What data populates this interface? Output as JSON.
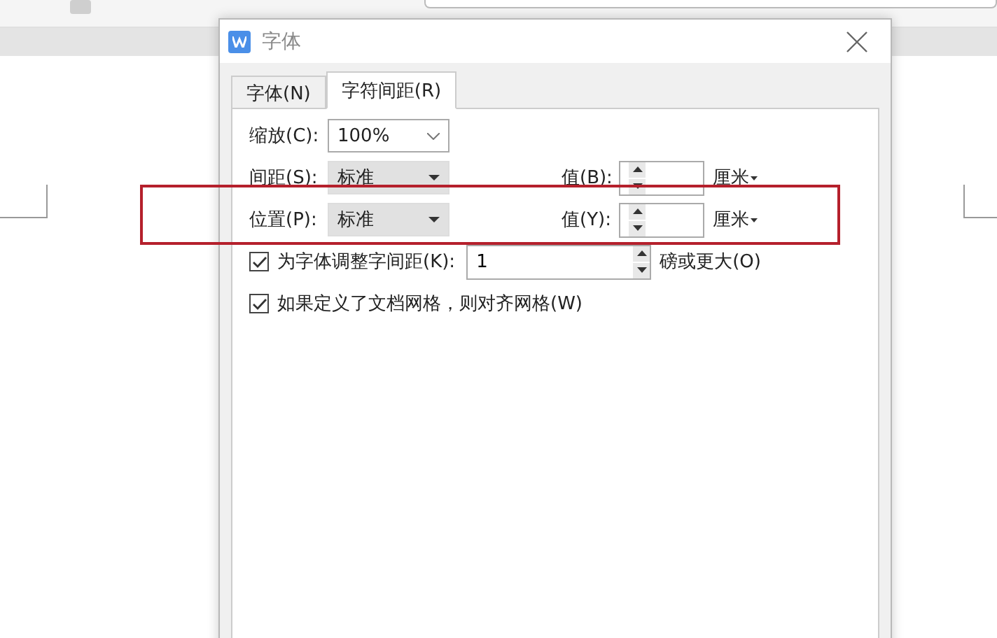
{
  "dialog": {
    "title": "字体",
    "tabs": [
      {
        "label": "字体(N)",
        "selected": false
      },
      {
        "label": "字符间距(R)",
        "selected": true
      }
    ],
    "scale": {
      "label": "缩放(C):",
      "value": "100%"
    },
    "rows": [
      {
        "label": "间距(S):",
        "value": "标准",
        "value_label": "值(B):",
        "unit": "厘米"
      },
      {
        "label": "位置(P):",
        "value": "标准",
        "value_label": "值(Y):",
        "unit": "厘米"
      }
    ],
    "kerning": {
      "label": "为字体调整字间距(K):",
      "checked": true,
      "value": "1",
      "suffix": "磅或更大(O)"
    },
    "grid": {
      "label": "如果定义了文档网格，则对齐网格(W)",
      "checked": true
    }
  }
}
